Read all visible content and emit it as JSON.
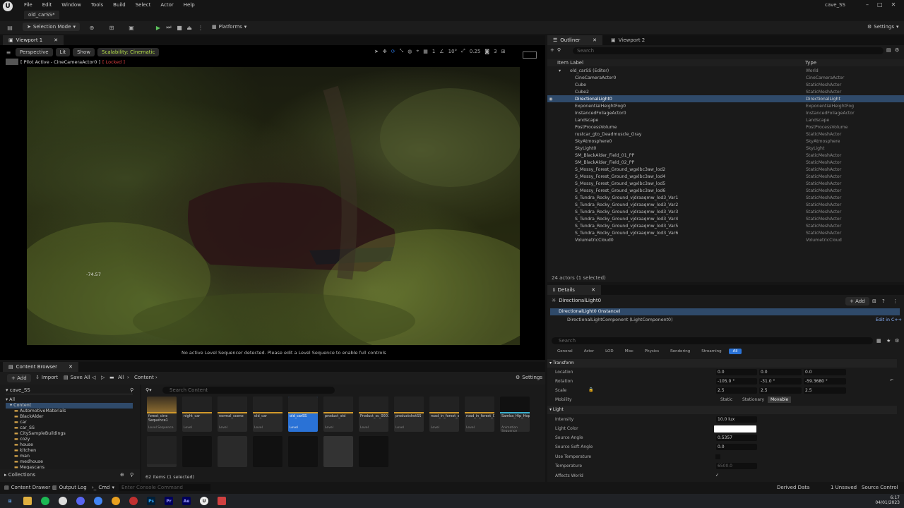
{
  "app": {
    "tab_title": "old_carSS*",
    "project": "cave_SS",
    "menu": [
      "File",
      "Edit",
      "Window",
      "Tools",
      "Build",
      "Select",
      "Actor",
      "Help"
    ]
  },
  "toolbar": {
    "mode": "Selection Mode",
    "platforms": "Platforms",
    "settings": "Settings"
  },
  "viewport": {
    "tab1": "Viewport 1",
    "perspective": "Perspective",
    "lit": "Lit",
    "show": "Show",
    "scalability": "Scalability: Cinematic",
    "pilot": "[ Pilot Active - CineCameraActor0 ]",
    "locked": "[ Locked ]",
    "readout": "-74.57",
    "bottom_msg": "No active Level Sequencer detected. Please edit a Level Sequence to enable full controls",
    "grid_val": "1",
    "angle": "10°",
    "scale": "0.25",
    "cam_speed": "3"
  },
  "outliner": {
    "tab": "Outliner",
    "tab2": "Viewport 2",
    "search_placeholder": "Search",
    "col_label": "Item Label",
    "col_type": "Type",
    "footer": "24 actors (1 selected)",
    "rows": [
      {
        "label": "old_carSS (Editor)",
        "type": "World"
      },
      {
        "label": "CineCameraActor0",
        "type": "CineCameraActor"
      },
      {
        "label": "Cube",
        "type": "StaticMeshActor"
      },
      {
        "label": "Cube2",
        "type": "StaticMeshActor"
      },
      {
        "label": "DirectionalLight0",
        "type": "DirectionalLight"
      },
      {
        "label": "ExponentialHeightFog0",
        "type": "ExponentialHeightFog"
      },
      {
        "label": "InstancedFoliageActor0",
        "type": "InstancedFoliageActor"
      },
      {
        "label": "Landscape",
        "type": "Landscape"
      },
      {
        "label": "PostProcessVolume",
        "type": "PostProcessVolume"
      },
      {
        "label": "rustcar_gto_Deadmuscle_Gray",
        "type": "StaticMeshActor"
      },
      {
        "label": "SkyAtmosphere0",
        "type": "SkyAtmosphere"
      },
      {
        "label": "SkyLight0",
        "type": "SkyLight"
      },
      {
        "label": "SM_BlackAlder_Field_01_PP",
        "type": "StaticMeshActor"
      },
      {
        "label": "SM_BlackAlder_Field_02_PP",
        "type": "StaticMeshActor"
      },
      {
        "label": "S_Mossy_Forest_Ground_wgxlbc3aw_lod2",
        "type": "StaticMeshActor"
      },
      {
        "label": "S_Mossy_Forest_Ground_wgxlbc3aw_lod4",
        "type": "StaticMeshActor"
      },
      {
        "label": "S_Mossy_Forest_Ground_wgxlbc3aw_lod5",
        "type": "StaticMeshActor"
      },
      {
        "label": "S_Mossy_Forest_Ground_wgxlbc3aw_lod6",
        "type": "StaticMeshActor"
      },
      {
        "label": "S_Tundra_Rocky_Ground_vjdraaqmw_lod3_Var1",
        "type": "StaticMeshActor"
      },
      {
        "label": "S_Tundra_Rocky_Ground_vjdraaqmw_lod3_Var2",
        "type": "StaticMeshActor"
      },
      {
        "label": "S_Tundra_Rocky_Ground_vjdraaqmw_lod3_Var3",
        "type": "StaticMeshActor"
      },
      {
        "label": "S_Tundra_Rocky_Ground_vjdraaqmw_lod3_Var4",
        "type": "StaticMeshActor"
      },
      {
        "label": "S_Tundra_Rocky_Ground_vjdraaqmw_lod3_Var5",
        "type": "StaticMeshActor"
      },
      {
        "label": "S_Tundra_Rocky_Ground_vjdraaqmw_lod3_Var6",
        "type": "StaticMeshActor"
      },
      {
        "label": "VolumetricCloud0",
        "type": "VolumetricCloud"
      }
    ]
  },
  "details": {
    "tab": "Details",
    "actor": "DirectionalLight0",
    "add": "+ Add",
    "instance": "DirectionalLight0 (Instance)",
    "component": "DirectionalLightComponent (LightComponent0)",
    "edit_cpp": "Edit in C++",
    "search_placeholder": "Search",
    "filters": [
      "General",
      "Actor",
      "LOD",
      "Misc",
      "Physics",
      "Rendering",
      "Streaming",
      "All"
    ],
    "transform": "Transform",
    "location": "Location",
    "rotation": "Rotation",
    "scale": "Scale",
    "mobility": "Mobility",
    "loc": [
      "0.0",
      "0.0",
      "0.0"
    ],
    "rot": [
      "-105.0 °",
      "-31.0 °",
      "-59.3680 °"
    ],
    "scl": [
      "2.5",
      "2.5",
      "2.5"
    ],
    "mob": [
      "Static",
      "Stationary",
      "Movable"
    ],
    "light": "Light",
    "intensity": "Intensity",
    "intensity_v": "10.0 lux",
    "light_color": "Light Color",
    "source_angle": "Source Angle",
    "source_angle_v": "0.5357",
    "source_soft": "Source Soft Angle",
    "source_soft_v": "0.0",
    "use_temp": "Use Temperature",
    "temperature": "Temperature",
    "temperature_v": "6500.0",
    "affects": "Affects World"
  },
  "content": {
    "tab": "Content Browser",
    "add": "+ Add",
    "import": "Import",
    "save_all": "Save All",
    "path1": "All",
    "path2": "Content",
    "settings": "Settings",
    "search_placeholder": "Search Content",
    "root": "cave_SS",
    "count": "62 items (1 selected)",
    "collections": "Collections",
    "tree": [
      "All",
      "Content",
      "AutomotiveMaterials",
      "BlackAlder",
      "car",
      "car_SS",
      "CitySampleBuildings",
      "cozy",
      "house",
      "kitchen",
      "man",
      "medhouse",
      "Megascans"
    ],
    "tiles": [
      {
        "name": "forest_cine Sequence1",
        "kind": "Level Sequence"
      },
      {
        "name": "night_car",
        "kind": "Level"
      },
      {
        "name": "normal_scene",
        "kind": "Level"
      },
      {
        "name": "old_car",
        "kind": "Level"
      },
      {
        "name": "old_carSS",
        "kind": "Level"
      },
      {
        "name": "product_std",
        "kind": "Level"
      },
      {
        "name": "Product_sc_0002",
        "kind": "Level"
      },
      {
        "name": "productshotSS",
        "kind": "Level"
      },
      {
        "name": "road_in_forest_sideview_01",
        "kind": "Level"
      },
      {
        "name": "road_in_forest_02",
        "kind": "Level"
      },
      {
        "name": "Samba_Hip_Hop_Dance",
        "kind": "Animation Sequence"
      }
    ]
  },
  "status": {
    "drawer": "Content Drawer",
    "output": "Output Log",
    "cmd": "Cmd",
    "cmd_ph": "Enter Console Command",
    "derived": "Derived Data",
    "unsaved": "1 Unsaved",
    "source": "Source Control"
  },
  "taskbar": {
    "time": "6:17",
    "date": "04/01/2023"
  },
  "colors": {
    "accent": "#2a72d6",
    "scalability": "#b6e04a",
    "locked": "#e04040",
    "selected_row": "#2f4a6a",
    "asset_bar": "#d29a2b"
  }
}
